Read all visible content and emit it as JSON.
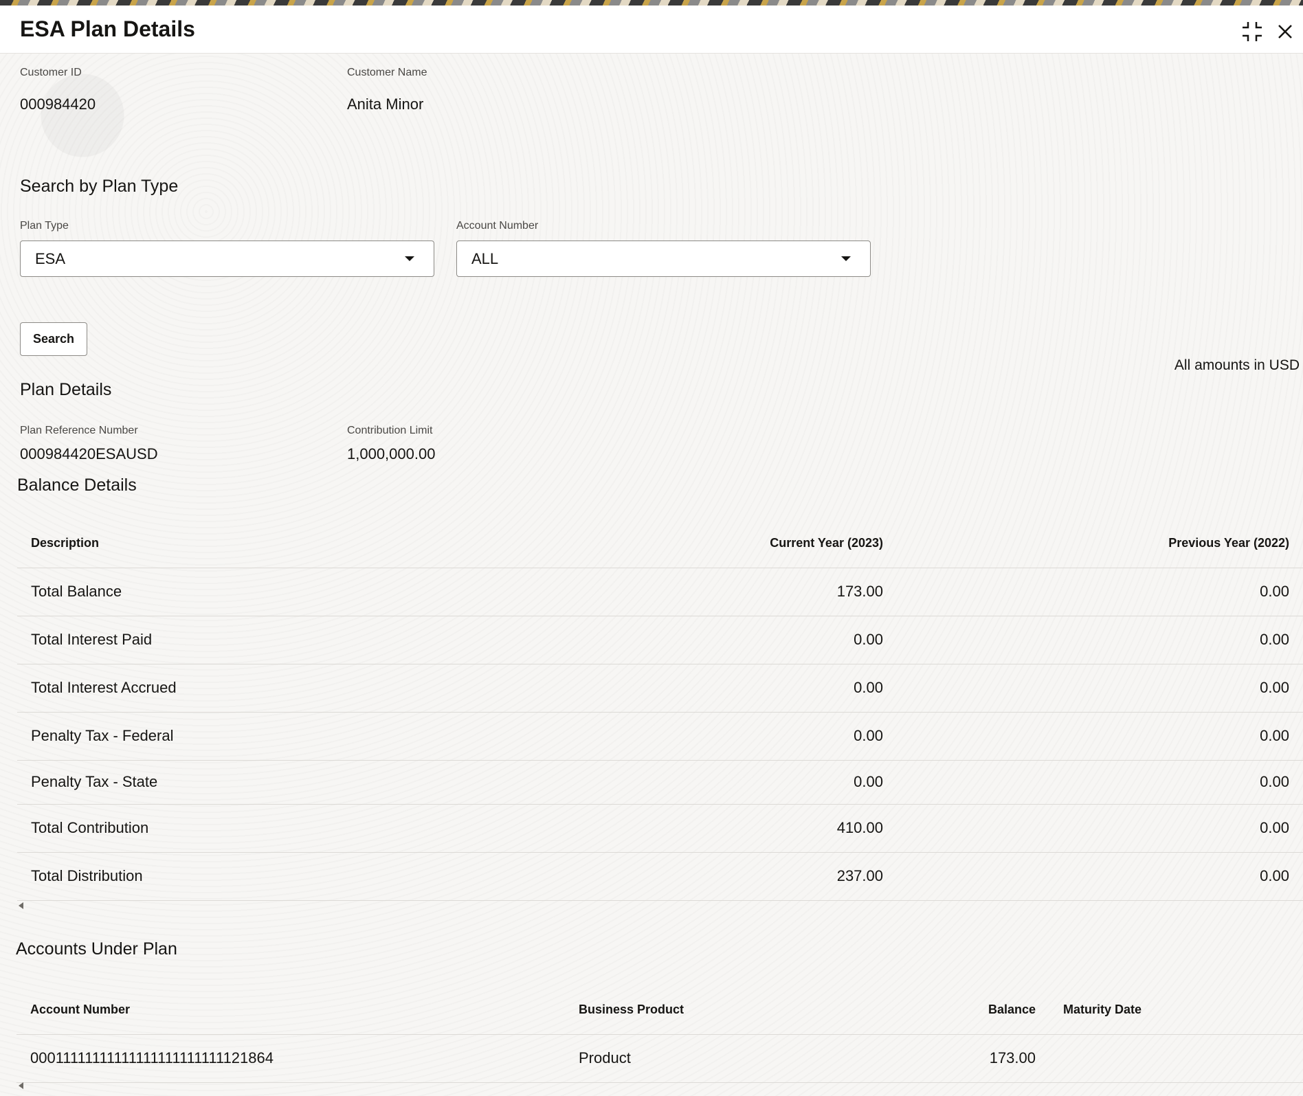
{
  "window": {
    "title": "ESA Plan Details",
    "collapse_icon": "collapse-icon",
    "close_icon": "close-icon"
  },
  "customer": {
    "id_label": "Customer ID",
    "id_value": "000984420",
    "name_label": "Customer Name",
    "name_value": "Anita Minor"
  },
  "search": {
    "section_title": "Search by Plan Type",
    "plan_type_label": "Plan Type",
    "plan_type_value": "ESA",
    "account_number_label": "Account Number",
    "account_number_value": "ALL",
    "search_button": "Search",
    "amounts_note": "All amounts in USD"
  },
  "plan_details": {
    "section_title": "Plan Details",
    "ref_label": "Plan Reference Number",
    "ref_value": "000984420ESAUSD",
    "limit_label": "Contribution Limit",
    "limit_value": "1,000,000.00"
  },
  "balance_details": {
    "section_title": "Balance Details",
    "columns": [
      "Description",
      "Current Year (2023)",
      "Previous Year (2022)"
    ],
    "rows": [
      {
        "description": "Total Balance",
        "current": "173.00",
        "previous": "0.00"
      },
      {
        "description": "Total Interest Paid",
        "current": "0.00",
        "previous": "0.00"
      },
      {
        "description": "Total Interest Accrued",
        "current": "0.00",
        "previous": "0.00"
      },
      {
        "description": "Penalty Tax - Federal",
        "current": "0.00",
        "previous": "0.00"
      },
      {
        "description": "Penalty Tax - State",
        "current": "0.00",
        "previous": "0.00"
      },
      {
        "description": "Total Contribution",
        "current": "410.00",
        "previous": "0.00"
      },
      {
        "description": "Total Distribution",
        "current": "237.00",
        "previous": "0.00"
      }
    ]
  },
  "accounts_under_plan": {
    "section_title": "Accounts Under Plan",
    "columns": [
      "Account Number",
      "Business Product",
      "Balance",
      "Maturity Date"
    ],
    "rows": [
      {
        "account_number": "00011111111111111111111111121864",
        "business_product": "Product",
        "balance": "173.00",
        "maturity_date": ""
      }
    ]
  }
}
